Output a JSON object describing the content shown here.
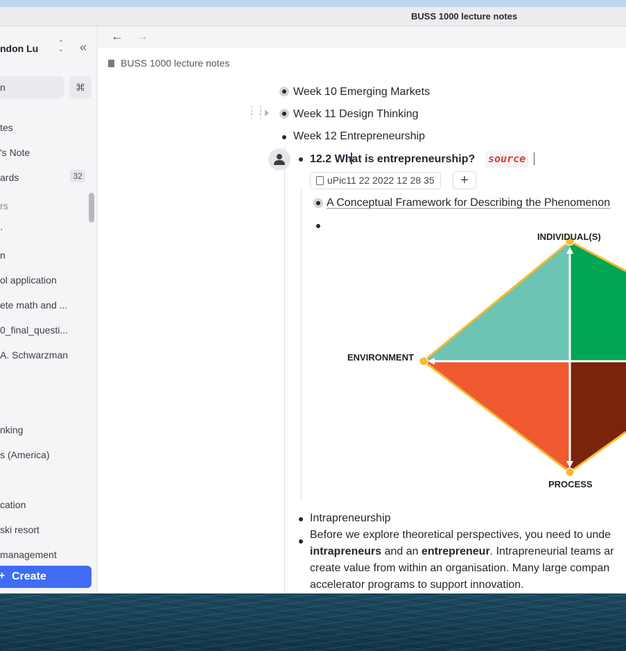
{
  "window": {
    "title": "BUSS 1000 lecture notes"
  },
  "sidebar": {
    "workspace_name": "ndon Lu",
    "search_placeholder": "n",
    "search_shortcut": "⌘",
    "nav": [
      {
        "label": "tes"
      },
      {
        "label": "'s Note"
      },
      {
        "label": "ards",
        "badge": "32"
      }
    ],
    "section_label": "rs",
    "pages": [
      "·",
      "n",
      "ol application",
      "ete math and ...",
      "0_final_questi...",
      "A. Schwarzman",
      "nking",
      "s (America)",
      "cation",
      " ski resort",
      "management"
    ],
    "create_label": "Create"
  },
  "breadcrumb": "BUSS 1000 lecture notes",
  "outline": {
    "week10": "Week 10 Emerging Markets",
    "week11": "Week 11 Design Thinking",
    "week12": "Week 12 Entrepreneurship",
    "heading_pre": "12.2 Wh",
    "heading_post": "at is entrepreneurship?",
    "tag": "source",
    "attachment": "uPic11 22 2022 12 28 35",
    "add_label": "+",
    "link_text": "A Conceptual Framework for Describing the Phenomenon",
    "intrapreneurship": "Intrapreneurship",
    "para_lines": [
      {
        "pre": "Before we explore theoretical perspectives, you need to unde",
        "b1": "",
        "mid": "",
        "b2": "",
        "post": ""
      },
      {
        "pre": "",
        "b1": "intrapreneurs",
        "mid": " and an ",
        "b2": "entrepreneur",
        "post": ". Intrapreneurial teams ar"
      },
      {
        "pre": "create value from within an organisation. Many large compan",
        "b1": "",
        "mid": "",
        "b2": "",
        "post": ""
      },
      {
        "pre": "accelerator programs to support innovation.",
        "b1": "",
        "mid": "",
        "b2": "",
        "post": ""
      }
    ]
  },
  "diagram": {
    "label_top": "INDIVIDUAL(S)",
    "label_left": "ENVIRONMENT",
    "label_bottom": "PROCESS",
    "colors": {
      "top_left": "#6bc4b4",
      "top_right": "#00a651",
      "bottom_left": "#ef5a31",
      "bottom_right": "#7a240c",
      "border": "#f6b931",
      "axis": "#ffffff"
    }
  }
}
